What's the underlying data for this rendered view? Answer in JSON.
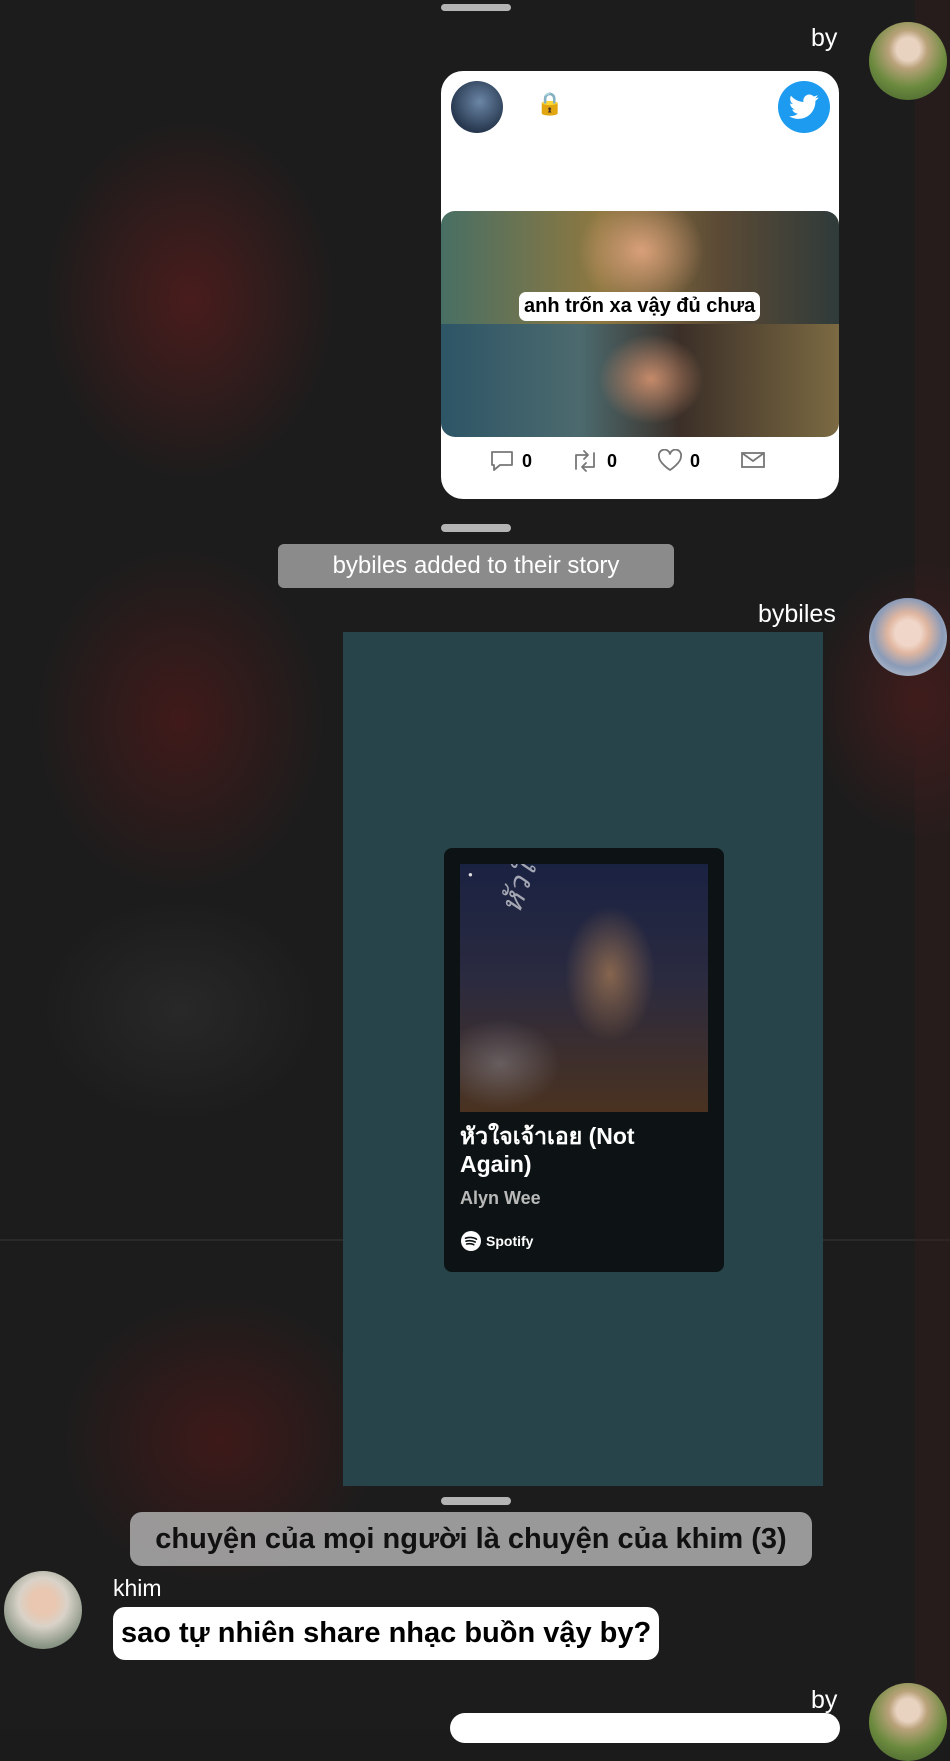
{
  "thread": {
    "handle_color": "#cfcfcf"
  },
  "post1": {
    "sender": "by",
    "tweet": {
      "caption": "anh trốn xa vậy đủ chưa",
      "reply_count": "0",
      "retweet_count": "0",
      "like_count": "0",
      "brand_color": "#1d9bf0"
    }
  },
  "story_event": {
    "text": "bybiles added to their story"
  },
  "post2": {
    "sender": "bybiles",
    "spotify": {
      "title": "หัวใจเจ้าเอย (Not Again)",
      "artist": "Alyn Wee",
      "brand": "Spotify",
      "album_script": "หัวใจเจ้าเอย"
    }
  },
  "group": {
    "name": "chuyện của mọi người là chuyện của khim (3)"
  },
  "message": {
    "sender": "khim",
    "text": "sao tự nhiên share nhạc buồn vậy by?"
  },
  "post3": {
    "sender": "by"
  }
}
